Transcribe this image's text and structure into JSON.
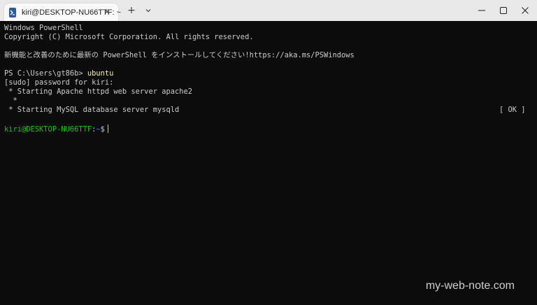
{
  "window": {
    "tab_title": "kiri@DESKTOP-NU66TTF: ~",
    "tab_icon": "powershell-icon",
    "new_tab_icon": "plus-icon",
    "dropdown_icon": "chevron-down-icon",
    "minimize_icon": "minimize-icon",
    "maximize_icon": "maximize-icon",
    "close_icon": "close-icon"
  },
  "terminal": {
    "lines": [
      "Windows PowerShell",
      "Copyright (C) Microsoft Corporation. All rights reserved.",
      "新機能と改善のために最新の PowerShell をインストールしてください!https://aka.ms/PSWindows",
      "PS C:\\Users\\gt86b> ",
      "ubuntu",
      "[sudo] password for kiri:",
      " * Starting Apache httpd web server apache2",
      "  *",
      " * Starting MySQL database server mysqld",
      "[ OK ]"
    ],
    "prompt_user": "kiri@DESKTOP-NU66TTF",
    "prompt_sep": ":",
    "prompt_path": "~",
    "prompt_end": "$"
  },
  "watermark": "my-web-note.com",
  "colors": {
    "background": "#0c0c0c",
    "text": "#cccccc",
    "command": "#f9f1a5",
    "prompt_user": "#16c60c",
    "prompt_path": "#3b78ff"
  }
}
